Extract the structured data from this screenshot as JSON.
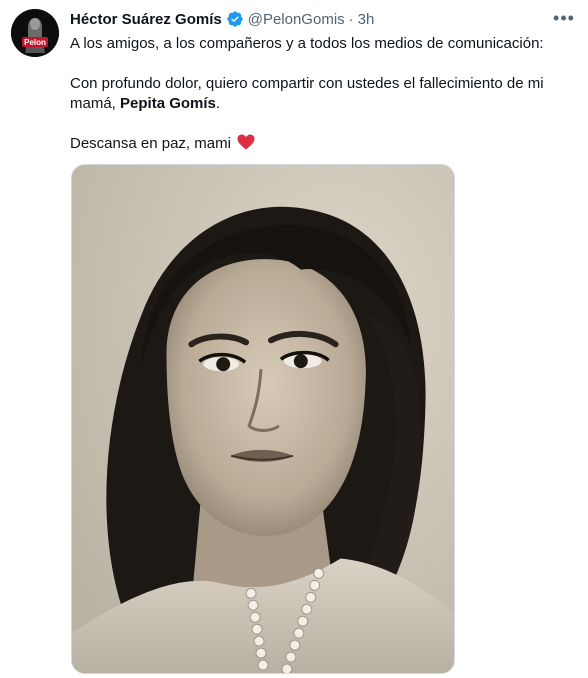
{
  "tweet": {
    "author_name": "Héctor Suárez Gomís",
    "handle": "@PelonGomis",
    "separator": "·",
    "time": "3h",
    "more_label": "•••",
    "line1": "A los amigos, a los compañeros y a todos los medios de comunicación:",
    "line2_prefix": "Con profundo dolor, quiero compartir con ustedes el fallecimiento de mi mamá, ",
    "line2_bold": "Pepita Gomís",
    "line2_suffix": ".",
    "line3": "Descansa en paz, mami",
    "heart_icon": "red-heart-emoji",
    "verified_icon": "verified-badge-icon",
    "avatar_logo_text": "Pelon",
    "colors": {
      "accent_blue": "#1d9bf0",
      "heart_red": "#e0245e",
      "secondary_text": "#536471"
    }
  }
}
